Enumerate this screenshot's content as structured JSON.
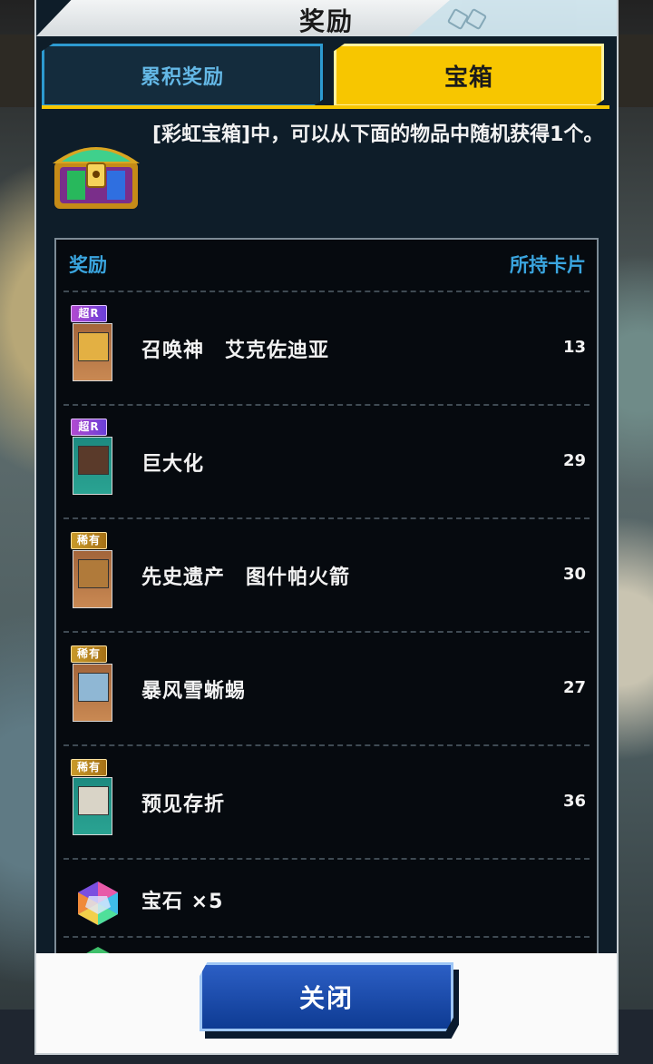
{
  "dialog": {
    "title": "奖励",
    "tabs": [
      {
        "label": "累积奖励",
        "selected": false
      },
      {
        "label": "宝箱",
        "selected": true
      }
    ],
    "description": "[彩虹宝箱]中，可以从下面的物品中随机获得1个。",
    "list_header": {
      "left": "奖励",
      "right": "所持卡片"
    },
    "items": [
      {
        "rarity": "超R",
        "name": "召唤神　艾克佐迪亚",
        "count": "13",
        "card_type": "monster"
      },
      {
        "rarity": "超R",
        "name": "巨大化",
        "count": "29",
        "card_type": "spell"
      },
      {
        "rarity": "稀有",
        "name": "先史遗产　图什帕火箭",
        "count": "30",
        "card_type": "monster"
      },
      {
        "rarity": "稀有",
        "name": "暴风雪蜥蜴",
        "count": "27",
        "card_type": "monster"
      },
      {
        "rarity": "稀有",
        "name": "预见存折",
        "count": "36",
        "card_type": "spell"
      }
    ],
    "gem_item": {
      "name": "宝石 ×5"
    },
    "close_label": "关闭"
  },
  "colors": {
    "tab_active": "#f7c600",
    "tab_inactive_text": "#64b8e6",
    "header_text": "#3aa5df",
    "close_button": "#1a4fb0"
  }
}
